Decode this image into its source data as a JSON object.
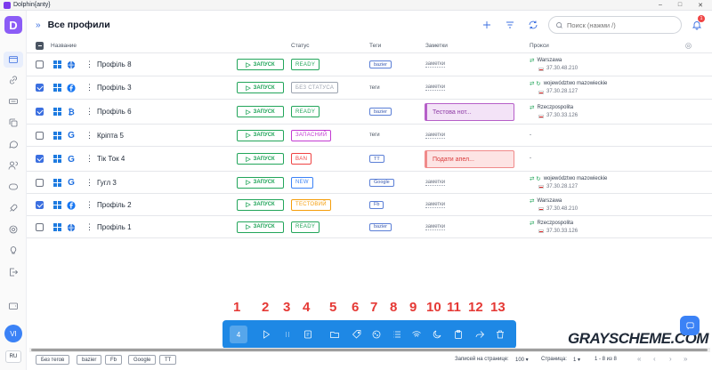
{
  "window": {
    "title": "Dolphin{anty}",
    "controls": [
      "–",
      "□",
      "✕"
    ]
  },
  "sidebar": {
    "logo": "D",
    "avatar": "VI",
    "lang": "RU"
  },
  "header": {
    "title": "Все профили",
    "search_placeholder": "Поиск (нажми /)",
    "notif_count": "1"
  },
  "table": {
    "columns": {
      "name": "Название",
      "status": "Статус",
      "tags": "Теги",
      "notes": "Заметки",
      "proxy": "Прокси"
    },
    "run_label": "ЗАПУСК",
    "rows": [
      {
        "name": "Профіль 8",
        "checked": false,
        "brand": "globe",
        "status": "READY",
        "status_color": "#22a55a",
        "tag": "bazier",
        "tag_style": "box",
        "note": "заметки",
        "note_box": null,
        "proxy_city": "Warszawa",
        "proxy_ip": "37.30.48.210",
        "proxy_rot": "⇄"
      },
      {
        "name": "Профіль 3",
        "checked": true,
        "brand": "f",
        "status": "БЕЗ СТАТУСА",
        "status_color": "#9ca3af",
        "tag": "теги",
        "tag_style": "plain",
        "note": "заметки",
        "note_box": null,
        "proxy_city": "województwo mazowieckie",
        "proxy_ip": "37.30.28.127",
        "proxy_rot": "⇄ ↻"
      },
      {
        "name": "Профіль 6",
        "checked": true,
        "brand": "B",
        "status": "READY",
        "status_color": "#22a55a",
        "tag": "bazier",
        "tag_style": "box",
        "note": null,
        "note_box": {
          "text": "Тестова нот...",
          "bg": "#f3e3f7",
          "border": "#b65fc8",
          "color": "#8e3aa5"
        },
        "proxy_city": "Rzeczpospolita",
        "proxy_ip": "37.30.33.126",
        "proxy_rot": "⇄"
      },
      {
        "name": "Кріпта 5",
        "checked": false,
        "brand": "G",
        "status": "ЗАПАСНИЙ",
        "status_color": "#c23bd1",
        "tag": "теги",
        "tag_style": "plain",
        "note": "заметки",
        "note_box": null,
        "proxy_city": "-",
        "proxy_ip": "",
        "proxy_rot": ""
      },
      {
        "name": "Тік Ток 4",
        "checked": true,
        "brand": "G",
        "status": "BAN",
        "status_color": "#ef4444",
        "tag": "TT",
        "tag_style": "box",
        "note": null,
        "note_box": {
          "text": "Подати апел...",
          "bg": "#fde4e4",
          "border": "#f08a8a",
          "color": "#d93a3a"
        },
        "proxy_city": "-",
        "proxy_ip": "",
        "proxy_rot": ""
      },
      {
        "name": "Гугл 3",
        "checked": false,
        "brand": "G",
        "status": "NEW",
        "status_color": "#3b82f6",
        "tag": "Google",
        "tag_style": "box",
        "note": "заметки",
        "note_box": null,
        "proxy_city": "województwo mazowieckie",
        "proxy_ip": "37.30.28.127",
        "proxy_rot": "⇄ ↻"
      },
      {
        "name": "Профіль 2",
        "checked": true,
        "brand": "f",
        "status": "ТЕСТОВИЙ",
        "status_color": "#f59e0b",
        "tag": "Fb",
        "tag_style": "box",
        "note": "заметки",
        "note_box": null,
        "proxy_city": "Warszawa",
        "proxy_ip": "37.30.48.210",
        "proxy_rot": "⇄"
      },
      {
        "name": "Профіль 1",
        "checked": false,
        "brand": "globe",
        "status": "READY",
        "status_color": "#22a55a",
        "tag": "bazier",
        "tag_style": "box",
        "note": "заметки",
        "note_box": null,
        "proxy_city": "Rzeczpospolita",
        "proxy_ip": "37.30.33.126",
        "proxy_rot": "⇄"
      }
    ]
  },
  "annotations": [
    "1",
    "2",
    "3",
    "4",
    "5",
    "6",
    "7",
    "8",
    "9",
    "10",
    "11",
    "12",
    "13"
  ],
  "toolbar": {
    "selected_count": "4",
    "icons": [
      "play-icon",
      "stop-icon",
      "note-icon",
      "folder-icon",
      "tag-icon",
      "cookie-icon",
      "list-icon",
      "wifi-icon",
      "moon-icon",
      "clipboard-icon",
      "share-icon",
      "trash-icon"
    ]
  },
  "watermark": "GRAYSCHEME.COM",
  "footer": {
    "tags": [
      "Без тегов",
      "bazier",
      "Fb",
      "Google",
      "TT"
    ],
    "per_page_label": "Записей на странице:",
    "per_page": "100",
    "page_label": "Страница:",
    "page": "1",
    "range": "1 - 8 из 8"
  }
}
